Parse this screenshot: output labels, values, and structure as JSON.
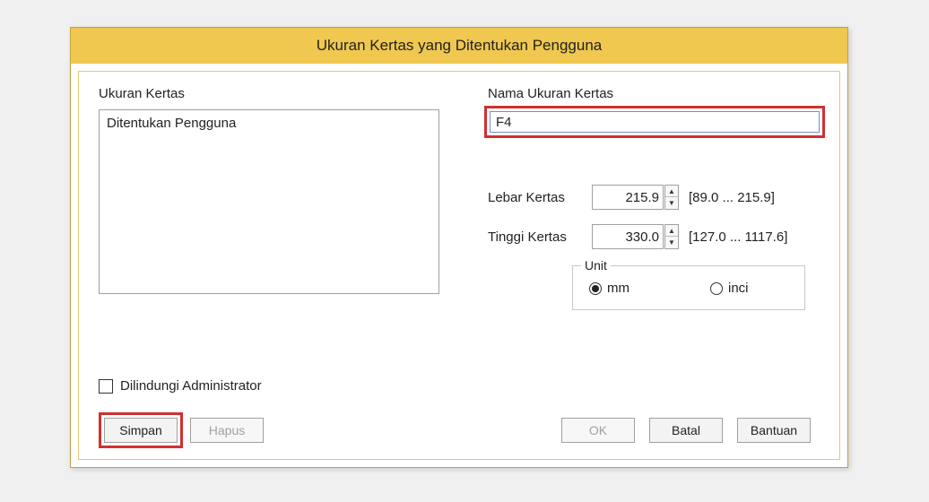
{
  "dialog": {
    "title": "Ukuran Kertas yang Ditentukan Pengguna",
    "paper_size_label": "Ukuran Kertas",
    "paper_size_items": [
      "Ditentukan Pengguna"
    ],
    "name_label": "Nama Ukuran Kertas",
    "name_value": "F4",
    "width_label": "Lebar Kertas",
    "width_value": "215.9",
    "width_range": "[89.0 ... 215.9]",
    "height_label": "Tinggi Kertas",
    "height_value": "330.0",
    "height_range": "[127.0 ... 1117.6]",
    "unit": {
      "legend": "Unit",
      "mm_label": "mm",
      "inci_label": "inci",
      "selected": "mm"
    },
    "protected_label": "Dilindungi Administrator",
    "protected_checked": false,
    "buttons": {
      "simpan": "Simpan",
      "hapus": "Hapus",
      "ok": "OK",
      "batal": "Batal",
      "bantuan": "Bantuan"
    }
  }
}
